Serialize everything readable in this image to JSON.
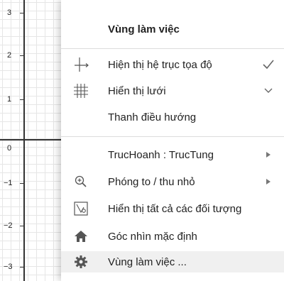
{
  "graph": {
    "y_tick_labels": [
      "3",
      "2",
      "1",
      "0",
      "−1",
      "−2",
      "−3"
    ]
  },
  "menu": {
    "title": "Vùng làm việc",
    "items": [
      {
        "label": "Hiện thị hệ trục tọa độ",
        "icon": "axes-icon",
        "right": "checkmark-icon"
      },
      {
        "label": "Hiển thị lưới",
        "icon": "grid-icon",
        "right": "chevron-down-icon"
      },
      {
        "label": "Thanh điều hướng",
        "icon": "",
        "right": ""
      },
      {
        "label": "TrucHoanh : TrucTung",
        "icon": "",
        "right": "submenu-arrow-icon"
      },
      {
        "label": "Phóng to / thu nhỏ",
        "icon": "zoom-icon",
        "right": "submenu-arrow-icon"
      },
      {
        "label": "Hiển thị tất cả các đối tượng",
        "icon": "show-all-objects-icon",
        "right": ""
      },
      {
        "label": "Góc nhìn mặc định",
        "icon": "home-icon",
        "right": ""
      },
      {
        "label": "Vùng làm việc ...",
        "icon": "gear-icon",
        "right": ""
      }
    ]
  }
}
